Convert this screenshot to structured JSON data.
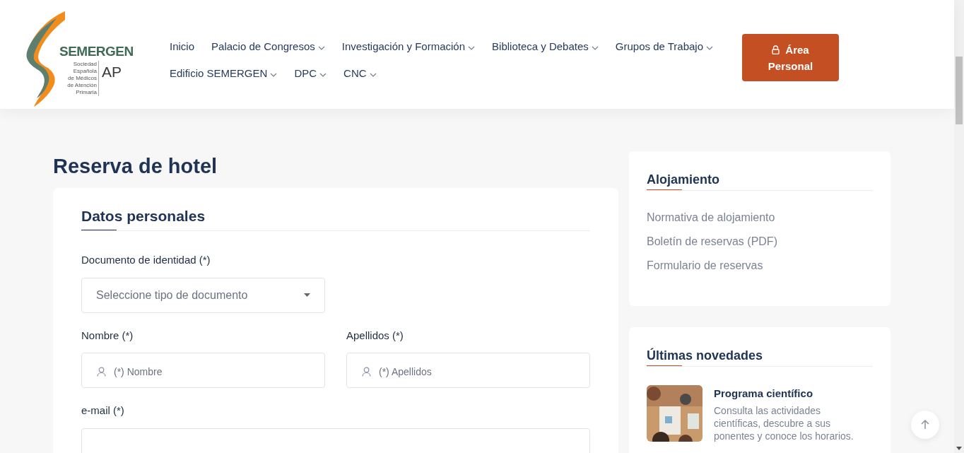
{
  "logo": {
    "name": "SEMERGEN",
    "subtitle": [
      "Sociedad",
      "Española",
      "de Médicos",
      "de Atención",
      "Primaria"
    ],
    "suffix": "AP"
  },
  "nav": [
    {
      "label": "Inicio",
      "dropdown": false
    },
    {
      "label": "Palacio de Congresos",
      "dropdown": true
    },
    {
      "label": "Investigación y Formación",
      "dropdown": true
    },
    {
      "label": "Biblioteca y Debates",
      "dropdown": true
    },
    {
      "label": "Grupos de Trabajo",
      "dropdown": true
    },
    {
      "label": "Edificio SEMERGEN",
      "dropdown": true
    },
    {
      "label": "DPC",
      "dropdown": true
    },
    {
      "label": "CNC",
      "dropdown": true
    }
  ],
  "account_button": {
    "label": "Área Personal"
  },
  "page_title": "Reserva de hotel",
  "form": {
    "title": "Datos personales",
    "document": {
      "label": "Documento de identidad (*)",
      "placeholder": "Seleccione tipo de documento"
    },
    "fields": [
      {
        "label": "Nombre (*)",
        "placeholder": "(*) Nombre"
      },
      {
        "label": "Apellidos (*)",
        "placeholder": "(*) Apellidos"
      }
    ],
    "email": {
      "label": "e-mail (*)"
    }
  },
  "sidebar": {
    "accommodation": {
      "title": "Alojamiento",
      "links": [
        "Normativa de alojamiento",
        "Boletín de reservas (PDF)",
        "Formulario de reservas"
      ]
    },
    "news": {
      "title": "Últimas novedades",
      "items": [
        {
          "title": "Programa científico",
          "text": "Consulta las actividades científicas, descubre a sus ponentes y conoce los horarios.",
          "kind": "picture"
        }
      ]
    }
  }
}
